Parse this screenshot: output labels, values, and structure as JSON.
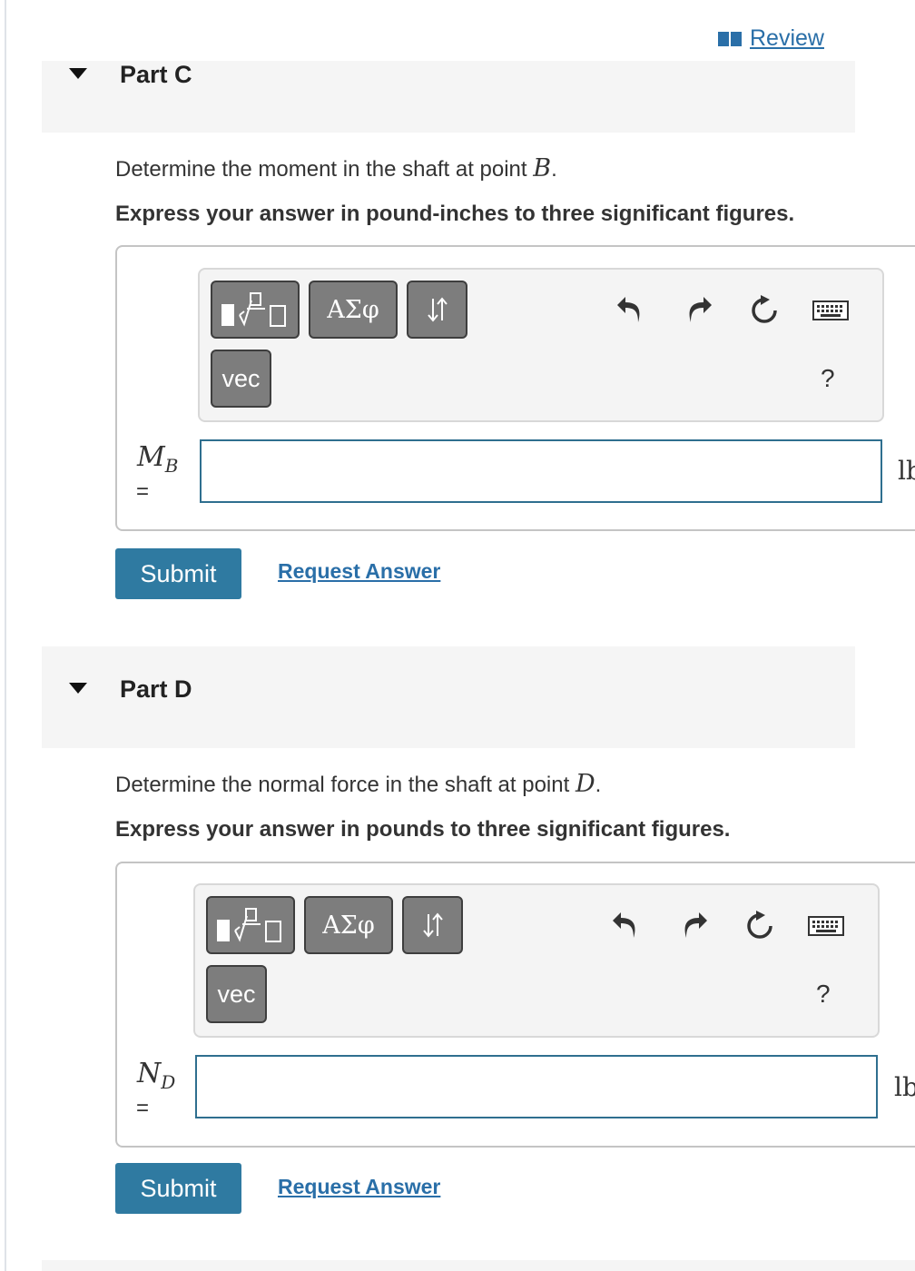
{
  "review": {
    "label": "Review",
    "icon": "book-icon",
    "color": "#2a6fa8"
  },
  "parts": [
    {
      "id": "C",
      "title": "Part C",
      "question_prefix": "Determine the moment in the shaft at point",
      "question_point": "B",
      "question_suffix": ".",
      "instruction": "Express your answer in pound-inches to three significant figures.",
      "toolbar": {
        "templates_icon": "fraction-sqrt-icon",
        "greek_label": "ΑΣφ",
        "arrows_icon": "up-down-arrows-icon",
        "vec_label": "vec",
        "undo_icon": "undo-icon",
        "redo_icon": "redo-icon",
        "reset_icon": "reset-icon",
        "keyboard_icon": "keyboard-icon",
        "help_label": "?"
      },
      "variable": {
        "symbol": "M",
        "subscript": "B",
        "equals": "="
      },
      "input_value": "",
      "unit": "lb",
      "submit_label": "Submit",
      "request_label": "Request Answer"
    },
    {
      "id": "D",
      "title": "Part D",
      "question_prefix": "Determine the normal force in the shaft at point",
      "question_point": "D",
      "question_suffix": ".",
      "instruction": "Express your answer in pounds to three significant figures.",
      "toolbar": {
        "templates_icon": "fraction-sqrt-icon",
        "greek_label": "ΑΣφ",
        "arrows_icon": "up-down-arrows-icon",
        "vec_label": "vec",
        "undo_icon": "undo-icon",
        "redo_icon": "redo-icon",
        "reset_icon": "reset-icon",
        "keyboard_icon": "keyboard-icon",
        "help_label": "?"
      },
      "variable": {
        "symbol": "N",
        "subscript": "D",
        "equals": "="
      },
      "input_value": "",
      "unit": "lb",
      "submit_label": "Submit",
      "request_label": "Request Answer"
    }
  ],
  "colors": {
    "accent": "#2f7aa1",
    "link": "#2a6fa8",
    "input_border": "#2f6f8f"
  }
}
